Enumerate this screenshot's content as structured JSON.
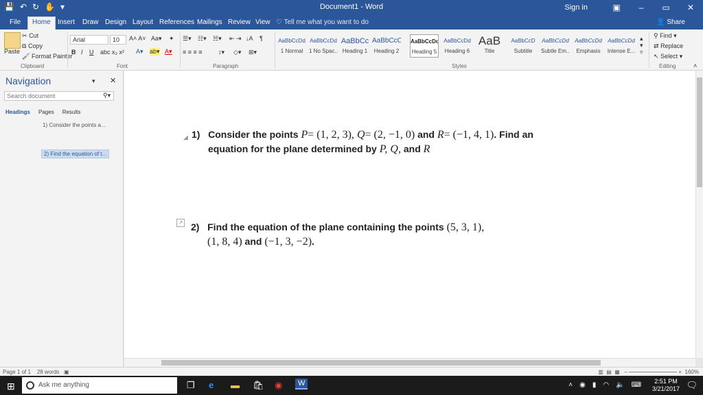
{
  "titlebar": {
    "title": "Document1 - Word",
    "signin": "Sign in",
    "minimize": "–",
    "restore": "▭",
    "close": "✕"
  },
  "qat": {
    "save": "💾",
    "undo": "↶",
    "redo": "↻",
    "touch": "✋",
    "customize": "▾"
  },
  "tabs": [
    "File",
    "Home",
    "Insert",
    "Draw",
    "Design",
    "Layout",
    "References",
    "Mailings",
    "Review",
    "View"
  ],
  "tell_me": "Tell me what you want to do",
  "share": "Share",
  "clipboard": {
    "paste": "Paste",
    "cut": "Cut",
    "copy": "Copy",
    "format_painter": "Format Painter",
    "label": "Clipboard"
  },
  "font": {
    "name": "Arial",
    "size": "10",
    "label": "Font"
  },
  "paragraph": {
    "label": "Paragraph"
  },
  "styles": {
    "label": "Styles",
    "items": [
      {
        "sample": "AaBbCcDd",
        "name": "1 Normal"
      },
      {
        "sample": "AaBbCcDd",
        "name": "1 No Spac..."
      },
      {
        "sample": "AaBbCc",
        "name": "Heading 1"
      },
      {
        "sample": "AaBbCcC",
        "name": "Heading 2"
      },
      {
        "sample": "AaBbCcDd",
        "name": "Heading 5"
      },
      {
        "sample": "AaBbCcDd",
        "name": "Heading 6"
      },
      {
        "sample": "AaB",
        "name": "Title"
      },
      {
        "sample": "AaBbCcD",
        "name": "Subtitle"
      },
      {
        "sample": "AaBbCcDd",
        "name": "Subtle Em..."
      },
      {
        "sample": "AaBbCcDd",
        "name": "Emphasis"
      },
      {
        "sample": "AaBbCcDd",
        "name": "Intense E..."
      }
    ]
  },
  "editing": {
    "find": "Find",
    "replace": "Replace",
    "select": "Select",
    "label": "Editing"
  },
  "nav": {
    "title": "Navigation",
    "search_placeholder": "Search document",
    "tabs": [
      "Headings",
      "Pages",
      "Results"
    ],
    "headings": [
      "1) Consider the points a...",
      "2) Find the equation of t..."
    ]
  },
  "doc": {
    "q1_num": "1)",
    "q1_a": "Consider the points",
    "q1_P": "P",
    "q1_Pv": "= (1, 2, 3),",
    "q1_Q": "Q",
    "q1_Qv": "= (2, −1, 0)",
    "q1_and": "and",
    "q1_R": "R",
    "q1_Rv": "= (−1, 4, 1)",
    "q1_b": ". Find an",
    "q1_line2a": "equation for the plane determined by",
    "q1_line2P": "P, Q,",
    "q1_line2and": "and",
    "q1_line2R": "R",
    "q2_num": "2)",
    "q2_a": "Find the equation of the plane containing the points",
    "q2_p1": "(5, 3, 1),",
    "q2_p2": "(1, 8, 4)",
    "q2_and": "and",
    "q2_p3": "(−1, 3, −2)",
    "q2_end": "."
  },
  "status": {
    "page": "Page 1 of 1",
    "words": "28 words",
    "zoom": "160%"
  },
  "taskbar": {
    "search": "Ask me anything",
    "time": "2:51 PM",
    "date": "3/21/2017"
  }
}
